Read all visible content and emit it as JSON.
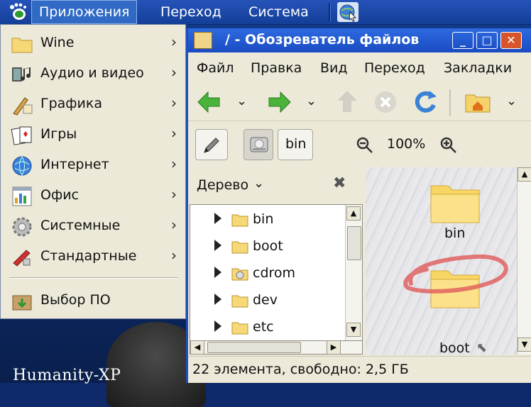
{
  "panel": {
    "menus": [
      "Приложения",
      "Переход",
      "Система"
    ],
    "logo_icon": "gnome-foot-icon",
    "network_icon": "globe-icon"
  },
  "app_menu": {
    "items": [
      {
        "label": "Wine",
        "icon": "folder-icon"
      },
      {
        "label": "Аудио и видео",
        "icon": "multimedia-icon"
      },
      {
        "label": "Графика",
        "icon": "graphics-icon"
      },
      {
        "label": "Игры",
        "icon": "cards-icon"
      },
      {
        "label": "Интернет",
        "icon": "globe-icon"
      },
      {
        "label": "Офис",
        "icon": "office-icon"
      },
      {
        "label": "Системные",
        "icon": "gear-icon"
      },
      {
        "label": "Стандартные",
        "icon": "accessories-icon"
      }
    ],
    "software_item": {
      "label": "Выбор ПО",
      "icon": "package-icon"
    }
  },
  "desktop": {
    "brand": "Humanity-XP"
  },
  "window": {
    "title": "/ - Обозреватель файлов",
    "menubar": [
      "Файл",
      "Правка",
      "Вид",
      "Переход",
      "Закладки"
    ],
    "location": {
      "button": "bin",
      "zoom": "100%"
    },
    "sidebar": {
      "title": "Дерево",
      "tree": [
        "bin",
        "boot",
        "cdrom",
        "dev",
        "etc"
      ]
    },
    "icons": [
      "bin",
      "boot"
    ],
    "status": "22 элемента, свободно: 2,5 ГБ"
  },
  "colors": {
    "panel": "#1a4aa8",
    "titlebar": "#2457d0",
    "menu_highlight": "#316ac5",
    "folder": "#f5d26a",
    "annotation": "#e05a5a"
  }
}
